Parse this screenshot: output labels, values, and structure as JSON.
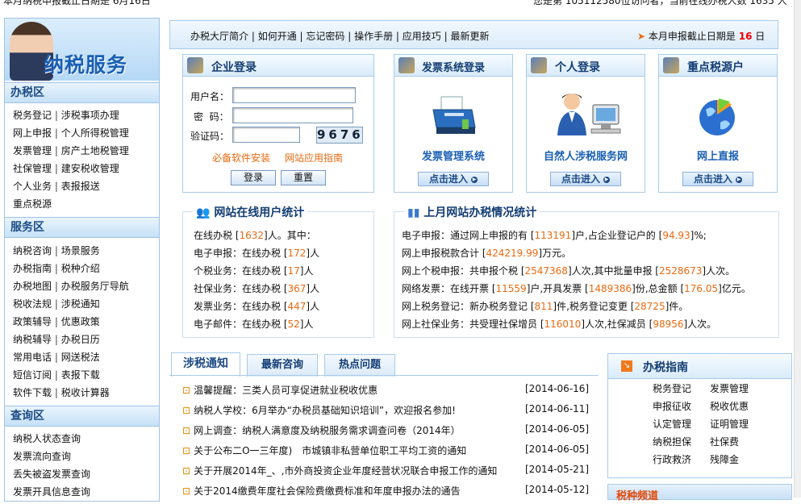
{
  "marquee": {
    "left": "本月纳税申报截止日期是 6月16日",
    "right": "您是第 105112580位访问者，当前在线办税人数 1635 人"
  },
  "sidebar": {
    "banner_title": "纳税服务",
    "sections": [
      {
        "title": "办税区",
        "links": [
          [
            "税务登记",
            "涉税事项办理"
          ],
          [
            "网上申报",
            "个人所得税管理"
          ],
          [
            "发票管理",
            "房产土地税管理"
          ],
          [
            "社保管理",
            "建安税收管理"
          ],
          [
            "个人业务",
            "表报报送"
          ],
          [
            "重点税源"
          ]
        ]
      },
      {
        "title": "服务区",
        "links": [
          [
            "纳税咨询",
            "场景服务"
          ],
          [
            "办税指南",
            "税种介绍"
          ],
          [
            "办税地图",
            "办税服务厅导航"
          ],
          [
            "税收法规",
            "涉税通知"
          ],
          [
            "政策辅导",
            "优惠政策"
          ],
          [
            "纳税辅导",
            "办税日历"
          ],
          [
            "常用电话",
            "网送税法"
          ],
          [
            "短信订阅",
            "表报下载"
          ],
          [
            "软件下载",
            "税收计算器"
          ]
        ]
      },
      {
        "title": "查询区",
        "links": [
          [
            "纳税人状态查询"
          ],
          [
            "发票流向查询"
          ],
          [
            "丢失被盗发票查询"
          ],
          [
            "发票开具信息查询"
          ]
        ]
      }
    ]
  },
  "nav": {
    "items": [
      "办税大厅简介",
      "如何开通",
      "忘记密码",
      "操作手册",
      "应用技巧",
      "最新更新"
    ],
    "notice_prefix": "本月申报截止日期是",
    "notice_day": "16",
    "notice_suffix": "日"
  },
  "login": {
    "title": "企业登录",
    "username_label": "用户名：",
    "password_label": "密  码：",
    "captcha_label": "验证码：",
    "captcha_value": "9676",
    "link1": "必备软件安装",
    "link2": "网站应用指南",
    "login_btn": "登录",
    "reset_btn": "重置"
  },
  "panels": [
    {
      "title": "发票系统登录",
      "name": "发票管理系统",
      "button": "点击进入",
      "icon": "printer-icon"
    },
    {
      "title": "个人登录",
      "name": "自然人涉税服务网",
      "button": "点击进入",
      "icon": "person-computer-icon"
    },
    {
      "title": "重点税源户",
      "name": "网上直报",
      "button": "点击进入",
      "icon": "globe-chart-icon"
    }
  ],
  "online_stats": {
    "title": "网站在线用户统计",
    "rows": [
      {
        "label": "在线办税 [",
        "value": "1632",
        "suffix": "]人。其中："
      },
      {
        "label": "电子申报：在线办税 [",
        "value": "172",
        "suffix": "]人"
      },
      {
        "label": "个税业务：在线办税 [",
        "value": "17",
        "suffix": "]人"
      },
      {
        "label": "社保业务：在线办税 [",
        "value": "367",
        "suffix": "]人"
      },
      {
        "label": "发票业务：在线办税 [",
        "value": "447",
        "suffix": "]人"
      },
      {
        "label": "电子邮件：在线办税 [",
        "value": "52",
        "suffix": "]人"
      }
    ]
  },
  "month_stats": {
    "title": "上月网站办税情况统计",
    "rows": [
      [
        "电子申报：通过网上申报的有 [",
        "113191",
        "]户,占企业登记户的 [",
        "94.93",
        "]%;"
      ],
      [
        "网上申报税款合计 [",
        "424219.99",
        "]万元。"
      ],
      [
        "网上个税申报：共申报个税 [",
        "2547368",
        "]人次,其中批量申报 [",
        "2528673",
        "]人次。"
      ],
      [
        "网络发票：在线开票 [",
        "11559",
        "]户,开具发票 [",
        "1489386",
        "]份,总金额 [",
        "176.05",
        "]亿元。"
      ],
      [
        "网上税务登记：新办税务登记 [",
        "811",
        "]件,税务登记变更 [",
        "28725",
        "]件。"
      ],
      [
        "网上社保业务：共受理社保增员 [",
        "116010",
        "]人次,社保减员 [",
        "98956",
        "]人次。"
      ]
    ]
  },
  "tabs": [
    "涉税通知",
    "最新咨询",
    "热点问题"
  ],
  "news": [
    {
      "title": "温馨提醒：三类人员可享促进就业税收优惠",
      "date": "[2014-06-16]"
    },
    {
      "title": "纳税人学校：6月举办“办税员基础知识培训”，欢迎报名参加!",
      "date": "[2014-06-11]"
    },
    {
      "title": "网上调查：纳税人满意度及纳税服务需求调查问卷（2014年）",
      "date": "[2014-06-05]"
    },
    {
      "title": "关于公布二O一三年度)　市城镇非私营单位职工平均工资的通知",
      "date": "[2014-06-05]"
    },
    {
      "title": "关于开展2014年_、,市外商投资企业年度经营状况联合申报工作的通知",
      "date": "[2014-05-21]"
    },
    {
      "title": "关于2014缴费年度社会保险费缴费标准和年度申报办法的通告",
      "date": "[2014-05-12]"
    }
  ],
  "guide": {
    "title": "办税指南",
    "items": [
      [
        "税务登记",
        "发票管理"
      ],
      [
        "申报征收",
        "税收优惠"
      ],
      [
        "认定管理",
        "证明管理"
      ],
      [
        "纳税担保",
        "社保费"
      ],
      [
        "行政救济",
        "残障金"
      ]
    ]
  },
  "bottom_right": {
    "title": "税种频道"
  }
}
